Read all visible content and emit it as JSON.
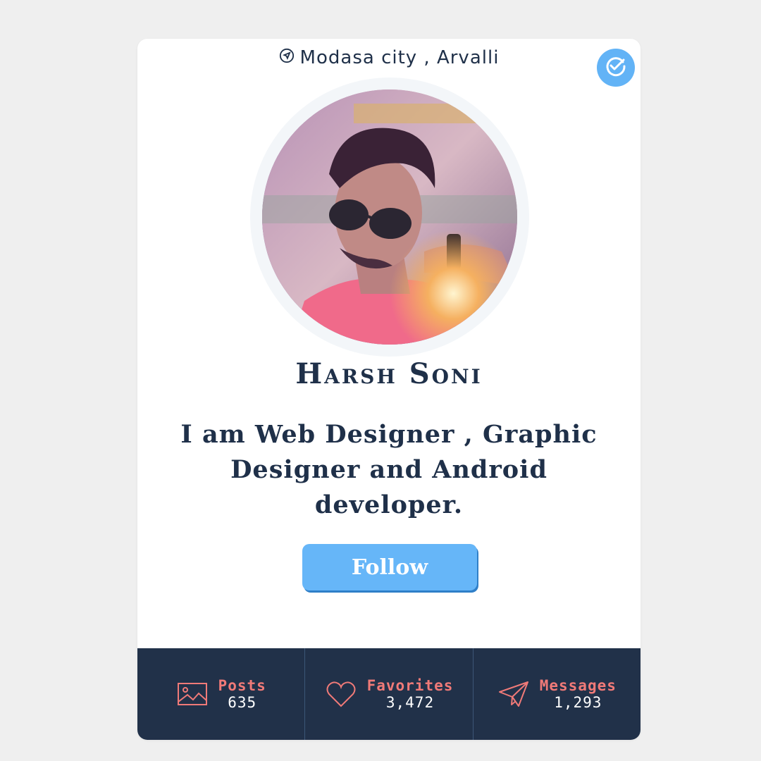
{
  "profile": {
    "location": "Modasa city , Arvalli",
    "name": "Harsh Soni",
    "bio": "I am Web Designer , Graphic Designer and Android developer.",
    "follow_label": "Follow"
  },
  "stats": [
    {
      "label": "Posts",
      "value": "635",
      "icon": "image-icon"
    },
    {
      "label": "Favorites",
      "value": "3,472",
      "icon": "heart-icon"
    },
    {
      "label": "Messages",
      "value": "1,293",
      "icon": "paper-plane-icon"
    }
  ],
  "colors": {
    "primary_text": "#1f3049",
    "accent_blue": "#66b6f8",
    "stats_bg": "#213149",
    "stats_label": "#f07a78"
  }
}
